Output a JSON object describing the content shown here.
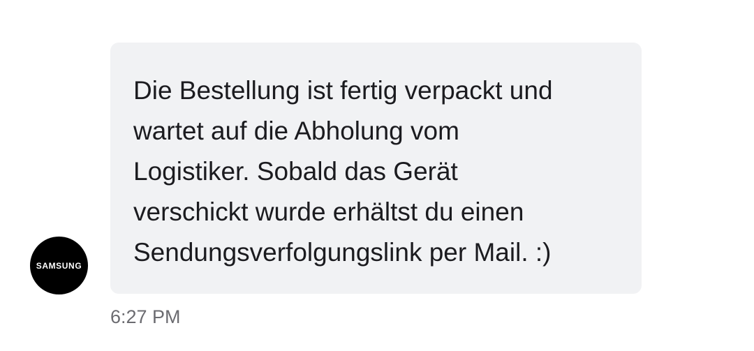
{
  "sender": {
    "avatar_label": "SAMSUNG"
  },
  "message": {
    "lines": [
      "Die Bestellung ist fertig verpackt und",
      "wartet auf die Abholung vom",
      "Logistiker. Sobald das Gerät",
      "verschickt wurde erhältst du einen",
      "Sendungsverfolgungslink per Mail. :)"
    ],
    "timestamp": "6:27 PM"
  },
  "colors": {
    "bubble_background": "#f1f2f4",
    "avatar_background": "#000000",
    "text": "#1b1b1f",
    "timestamp": "#6b6b70"
  }
}
